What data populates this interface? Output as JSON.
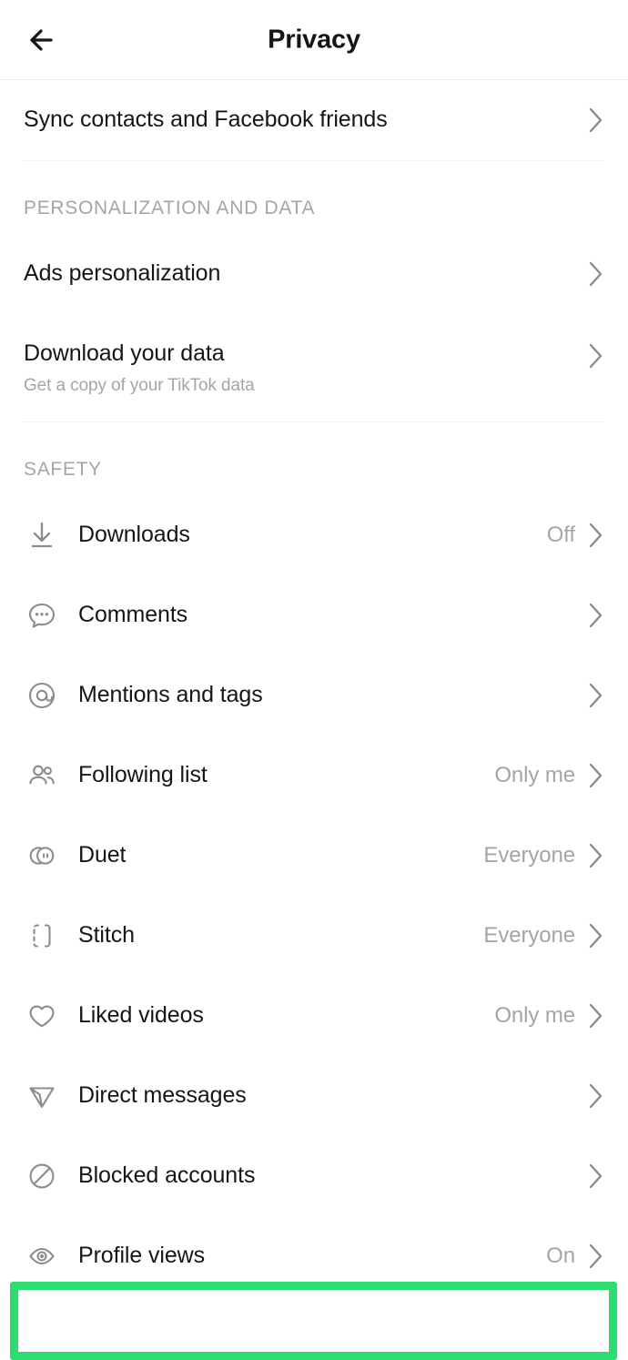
{
  "header": {
    "title": "Privacy",
    "back_icon": "arrow-left-icon"
  },
  "colors": {
    "highlight": "#2ddd6f",
    "label": "#15161a",
    "muted": "#a5a5a8",
    "divider": "#f1f1f2"
  },
  "groups": [
    {
      "header": null,
      "rows": [
        {
          "label": "Sync contacts and Facebook friends",
          "sub": null,
          "value": null,
          "icon": null,
          "chevron": "chevron-right-icon"
        }
      ]
    },
    {
      "header": "PERSONALIZATION AND DATA",
      "rows": [
        {
          "label": "Ads personalization",
          "sub": null,
          "value": null,
          "icon": null,
          "chevron": "chevron-right-icon"
        },
        {
          "label": "Download your data",
          "sub": "Get a copy of your TikTok data",
          "value": null,
          "icon": null,
          "chevron": "chevron-right-icon"
        }
      ]
    },
    {
      "header": "SAFETY",
      "rows": [
        {
          "label": "Downloads",
          "sub": null,
          "value": "Off",
          "icon": "download-icon",
          "chevron": "chevron-right-icon"
        },
        {
          "label": "Comments",
          "sub": null,
          "value": null,
          "icon": "comment-bubble-icon",
          "chevron": "chevron-right-icon"
        },
        {
          "label": "Mentions and tags",
          "sub": null,
          "value": null,
          "icon": "at-mention-icon",
          "chevron": "chevron-right-icon"
        },
        {
          "label": "Following list",
          "sub": null,
          "value": "Only me",
          "icon": "people-icon",
          "chevron": "chevron-right-icon"
        },
        {
          "label": "Duet",
          "sub": null,
          "value": "Everyone",
          "icon": "duet-circles-icon",
          "chevron": "chevron-right-icon"
        },
        {
          "label": "Stitch",
          "sub": null,
          "value": "Everyone",
          "icon": "stitch-bracket-icon",
          "chevron": "chevron-right-icon"
        },
        {
          "label": "Liked videos",
          "sub": null,
          "value": "Only me",
          "icon": "heart-icon",
          "chevron": "chevron-right-icon"
        },
        {
          "label": "Direct messages",
          "sub": null,
          "value": null,
          "icon": "send-plane-icon",
          "chevron": "chevron-right-icon"
        },
        {
          "label": "Blocked accounts",
          "sub": null,
          "value": null,
          "icon": "block-circle-icon",
          "chevron": "chevron-right-icon"
        },
        {
          "label": "Profile views",
          "sub": null,
          "value": "On",
          "icon": "eye-icon",
          "chevron": "chevron-right-icon",
          "highlighted": true
        }
      ]
    }
  ]
}
